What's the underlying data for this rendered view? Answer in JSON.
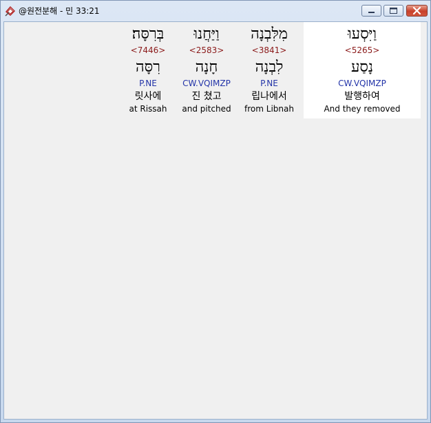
{
  "window": {
    "title": "@원전분해 - 민 33:21",
    "app_icon": "bible-app-icon",
    "controls": [
      "minimize-icon",
      "maximize-icon",
      "close-icon"
    ]
  },
  "colors": {
    "strong_number": "#8b1a1a",
    "parsing_code": "#2233a8",
    "selected_background": "#ffffff",
    "client_background": "#f0f0f0"
  },
  "words": [
    {
      "hebrew": "בְּרִסָּה׃",
      "strong": "<7446>",
      "root": "רִסָּה",
      "parsing": "P.NE",
      "korean": "릿사에",
      "english": "at Rissah",
      "selected": false
    },
    {
      "hebrew": "וַיַּחֲנוּ",
      "strong": "<2583>",
      "root": "חָנָה",
      "parsing": "CW.VQIMZP",
      "korean": "진 쳤고",
      "english": "and pitched",
      "selected": false
    },
    {
      "hebrew": "מִלִּבְנָה",
      "strong": "<3841>",
      "root": "לִבְנָה",
      "parsing": "P.NE",
      "korean": "립나에서",
      "english": "from Libnah",
      "selected": false
    },
    {
      "hebrew": "וַיִּסְעוּ",
      "strong": "<5265>",
      "root": "נָסַע",
      "parsing": "CW.VQIMZP",
      "korean": "발행하여",
      "english": "And they removed",
      "selected": true
    }
  ]
}
